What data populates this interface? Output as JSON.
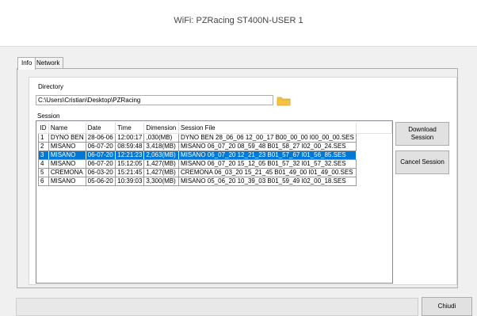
{
  "window": {
    "title": "WiFi: PZRacing ST400N-USER 1"
  },
  "tabs": [
    {
      "label": "Info",
      "active": true
    },
    {
      "label": "Network",
      "active": false
    }
  ],
  "directory": {
    "label": "Directory",
    "value": "C:\\Users\\Cristian\\Desktop\\PZRacing",
    "folder_icon": "folder-icon"
  },
  "session": {
    "label": "Session",
    "columns": [
      "ID",
      "Name",
      "Date",
      "Time",
      "Dimension",
      "Session File"
    ],
    "rows": [
      {
        "id": "1",
        "name": "DYNO BEN",
        "date": "28-06-06",
        "time": "12:00:17",
        "dimension": ",030(MB)",
        "file": "DYNO BEN 28_06_06 12_00_17 B00_00_00 I00_00_00.SES",
        "selected": false
      },
      {
        "id": "2",
        "name": "MISANO",
        "date": "06-07-20",
        "time": "08:59:48",
        "dimension": "3,418(MB)",
        "file": "MISANO  06_07_20 08_59_48 B01_58_27 I02_00_24.SES",
        "selected": false
      },
      {
        "id": "3",
        "name": "MISANO",
        "date": "06-07-20",
        "time": "12:21:23",
        "dimension": "2,063(MB)",
        "file": "MISANO  06_07_20 12_21_23 B01_57_67 I01_56_85.SES",
        "selected": true
      },
      {
        "id": "4",
        "name": "MISANO",
        "date": "06-07-20",
        "time": "15:12:05",
        "dimension": "1,427(MB)",
        "file": "MISANO  06_07_20 15_12_05 B01_57_32 I01_57_32.SES",
        "selected": false
      },
      {
        "id": "5",
        "name": "CREMONA",
        "date": "06-03-20",
        "time": "15:21:45",
        "dimension": "1,427(MB)",
        "file": "CREMONA  06_03_20 15_21_45 B01_49_00 I01_49_00.SES",
        "selected": false
      },
      {
        "id": "6",
        "name": "MISANO",
        "date": "05-06-20",
        "time": "10:39:03",
        "dimension": "3,300(MB)",
        "file": "MISANO  05_06_20 10_39_03 B01_59_49 I02_00_18.SES",
        "selected": false
      }
    ]
  },
  "buttons": {
    "download": "Download Session",
    "cancel": "Cancel Session",
    "close": "Chiudi"
  },
  "colors": {
    "selection": "#0078d7",
    "folder": "#f5c342"
  }
}
